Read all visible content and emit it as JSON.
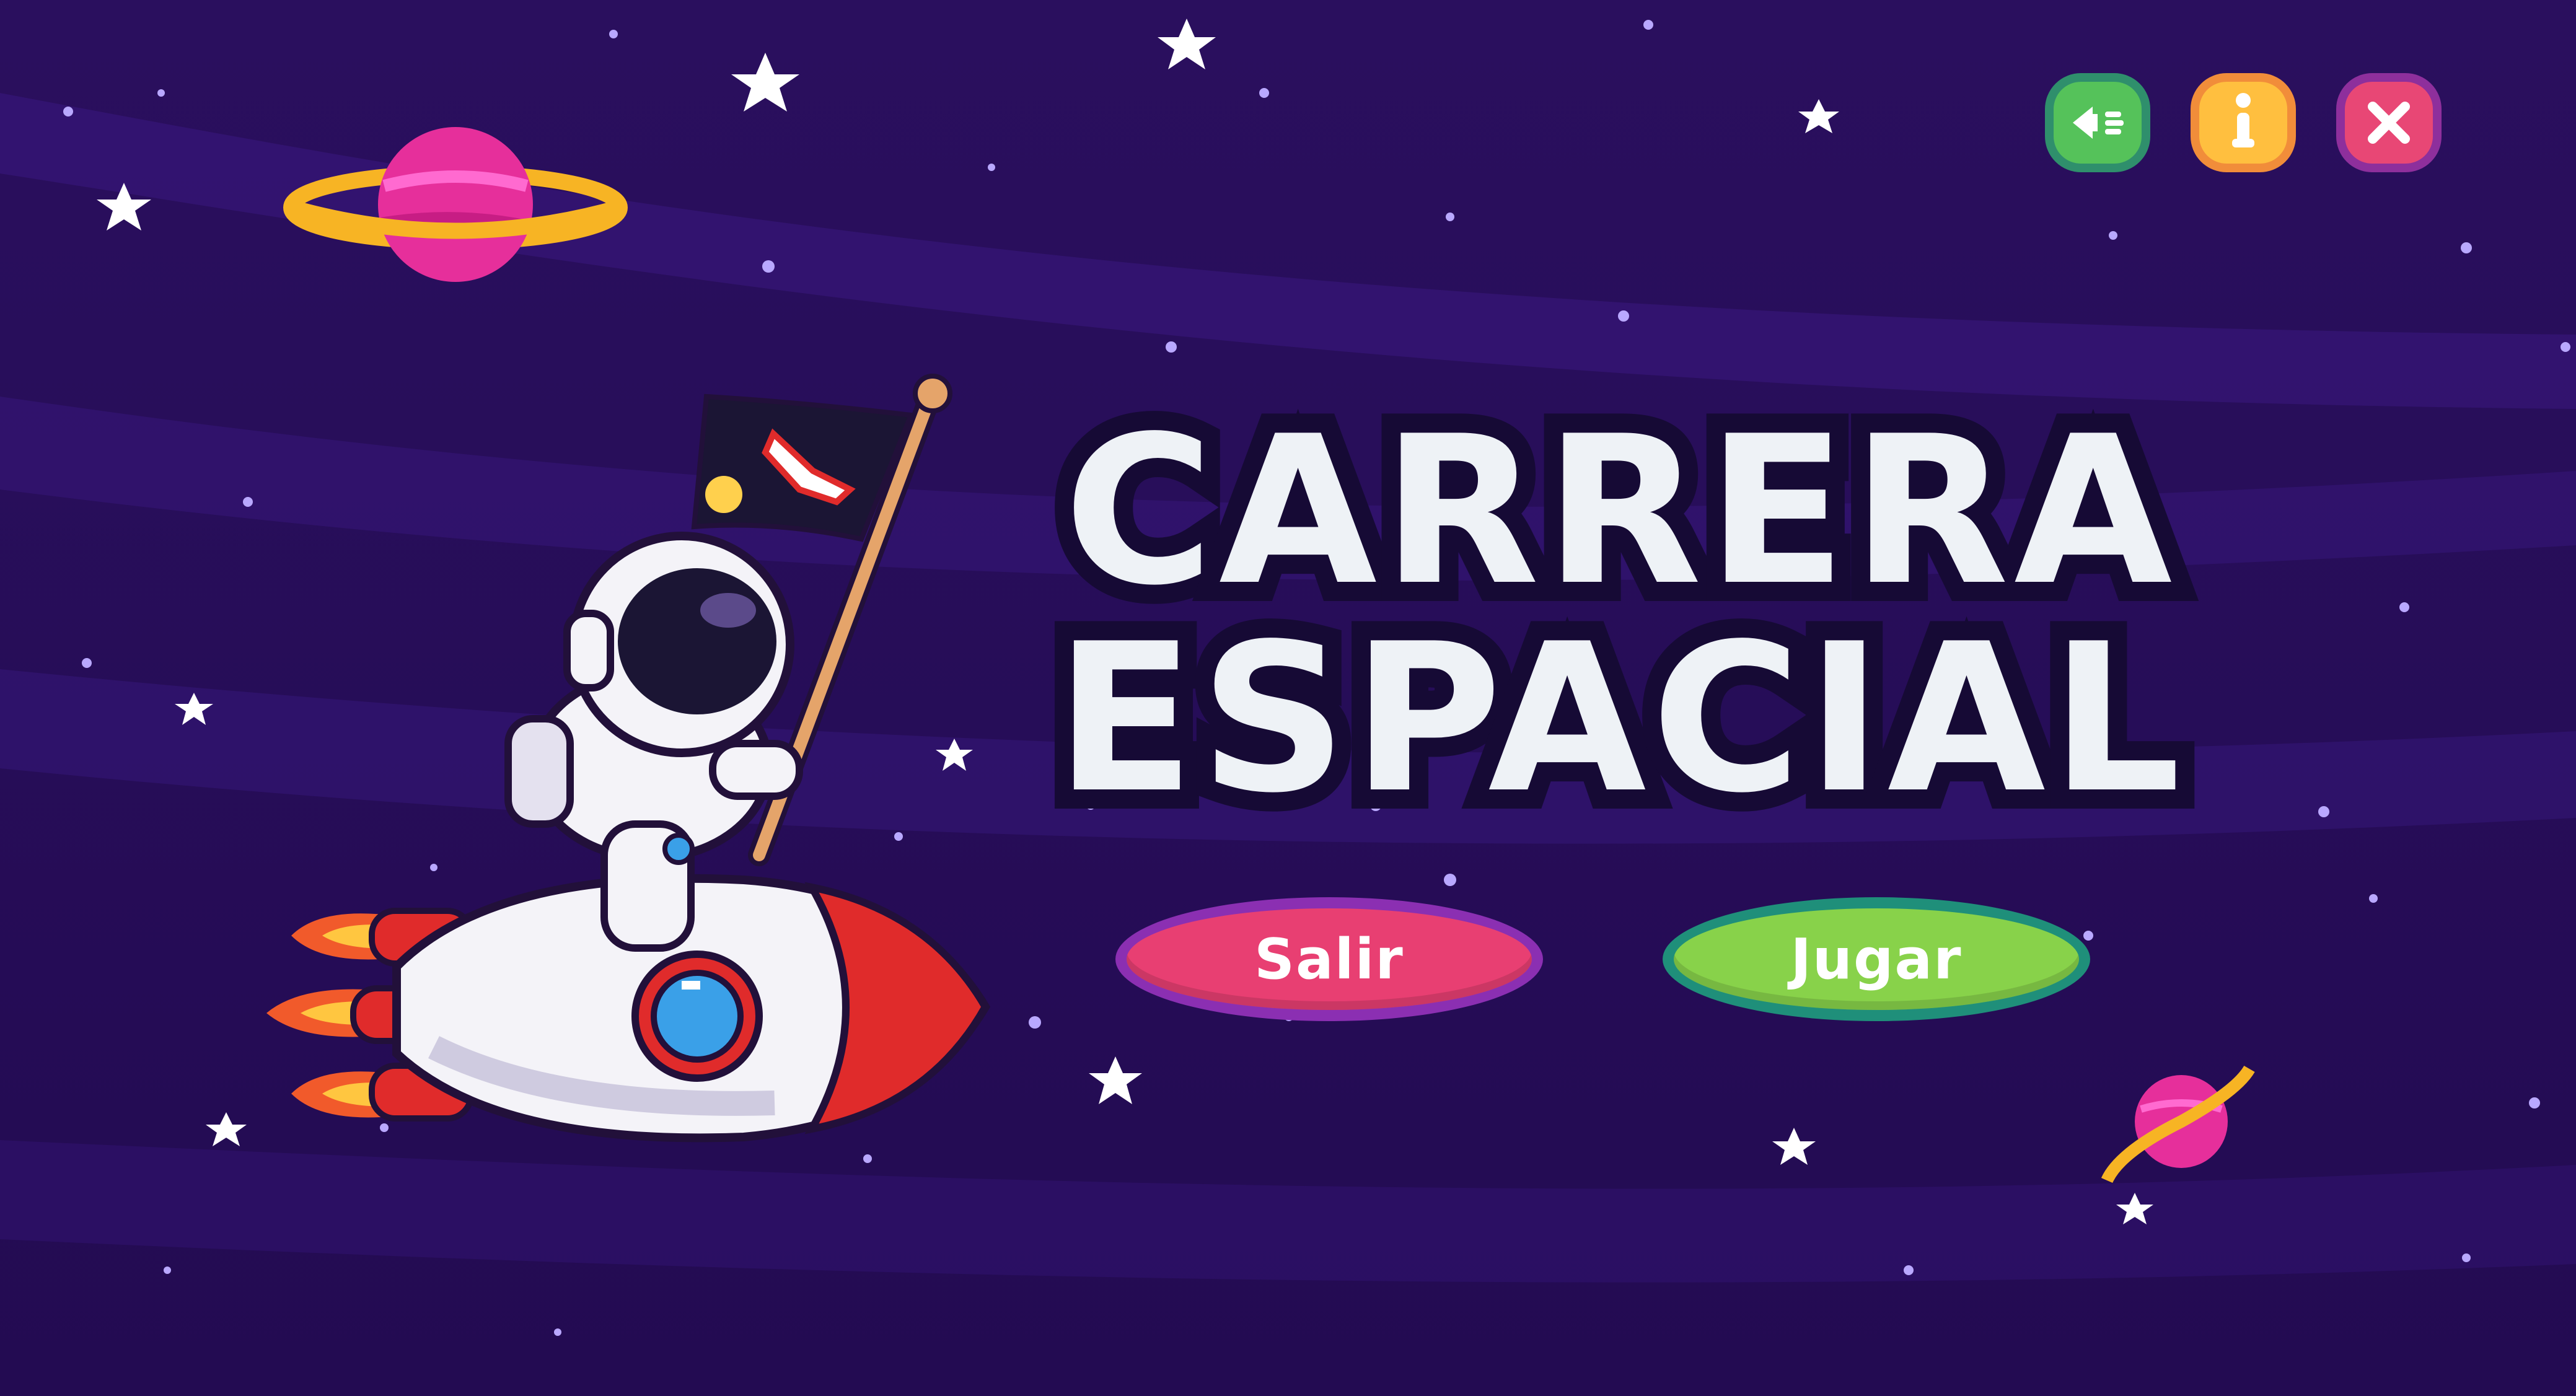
{
  "title": {
    "line1": "CARRERA",
    "line2": "ESPACIAL"
  },
  "buttons": {
    "exit_label": "Salir",
    "play_label": "Jugar"
  },
  "top_controls": [
    {
      "name": "sound",
      "icon": "speaker-icon"
    },
    {
      "name": "info",
      "icon": "info-icon"
    },
    {
      "name": "close",
      "icon": "close-icon"
    }
  ],
  "colors": {
    "background": "#2a0f5e",
    "title_fill": "#eef2f6",
    "title_outline": "#160a35",
    "exit_button": "#e83f72",
    "play_button": "#88d24a",
    "sound_button": "#55c25a",
    "info_button": "#ffbf3f",
    "close_button": "#e84775"
  }
}
